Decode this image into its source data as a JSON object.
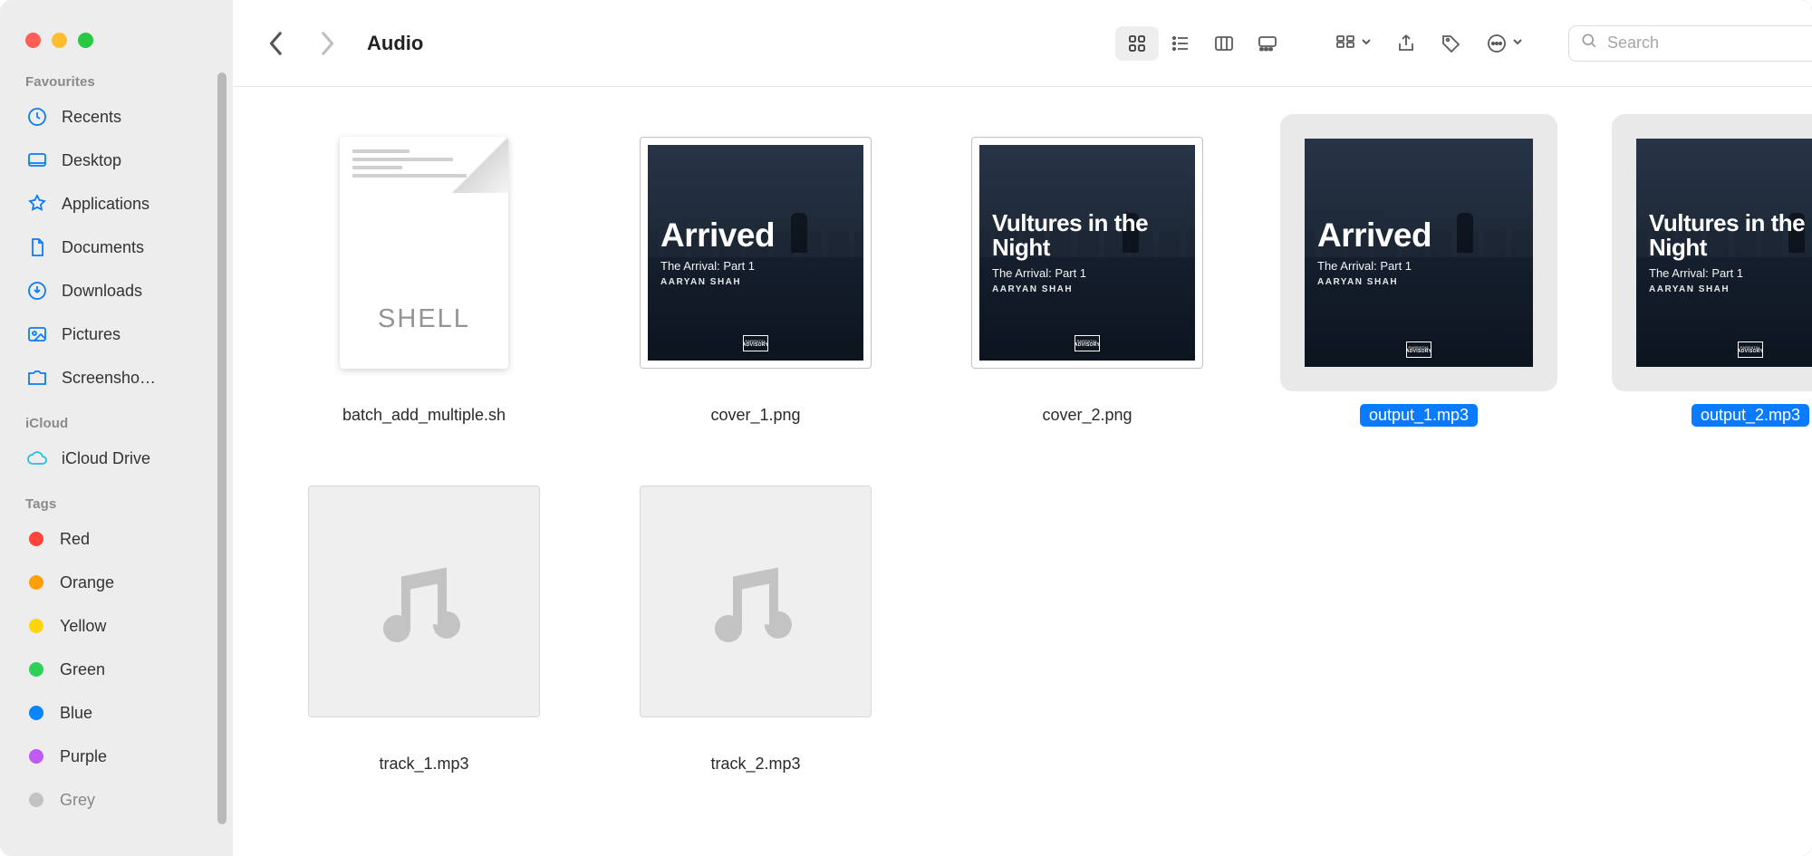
{
  "window": {
    "title": "Audio"
  },
  "sidebar": {
    "favourites_label": "Favourites",
    "favourites": [
      {
        "label": "Recents"
      },
      {
        "label": "Desktop"
      },
      {
        "label": "Applications"
      },
      {
        "label": "Documents"
      },
      {
        "label": "Downloads"
      },
      {
        "label": "Pictures"
      },
      {
        "label": "Screensho…"
      }
    ],
    "icloud_label": "iCloud",
    "icloud": [
      {
        "label": "iCloud Drive"
      }
    ],
    "tags_label": "Tags",
    "tags": [
      {
        "label": "Red",
        "color": "#ff453a"
      },
      {
        "label": "Orange",
        "color": "#ff9f0a"
      },
      {
        "label": "Yellow",
        "color": "#ffd60a"
      },
      {
        "label": "Green",
        "color": "#30d158"
      },
      {
        "label": "Blue",
        "color": "#0a84ff"
      },
      {
        "label": "Purple",
        "color": "#bf5af2"
      },
      {
        "label": "Grey",
        "color": "#a0a0a0"
      }
    ]
  },
  "toolbar": {
    "search_placeholder": "Search",
    "active_view": "icons"
  },
  "album": {
    "arrived_title": "Arrived",
    "vultures_title": "Vultures in the Night",
    "subtitle": "The Arrival: Part 1",
    "artist": "AARYAN SHAH"
  },
  "files": {
    "row1": [
      {
        "name": "batch_add_multiple.sh",
        "kind": "shell",
        "selected": false
      },
      {
        "name": "cover_1.png",
        "kind": "image",
        "art": "arrived",
        "selected": false
      },
      {
        "name": "cover_2.png",
        "kind": "image",
        "art": "vultures",
        "selected": false
      },
      {
        "name": "output_1.mp3",
        "kind": "audio-art",
        "art": "arrived",
        "selected": true
      },
      {
        "name": "output_2.mp3",
        "kind": "audio-art",
        "art": "vultures",
        "selected": true
      }
    ],
    "row2": [
      {
        "name": "track_1.mp3",
        "kind": "audio",
        "selected": false
      },
      {
        "name": "track_2.mp3",
        "kind": "audio",
        "selected": false
      }
    ]
  },
  "shell_type_label": "SHELL"
}
